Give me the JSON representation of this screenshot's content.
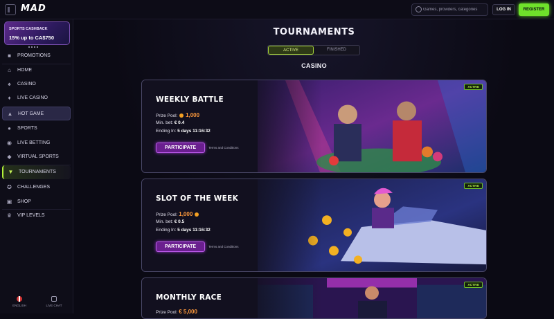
{
  "header": {
    "logo": "MAD",
    "search_placeholder": "Games, providers, categories",
    "login_label": "LOG IN",
    "register_label": "REGISTER"
  },
  "sidebar": {
    "promo": {
      "title": "SPORTS CASHBACK",
      "text": "15% up to CA$750"
    },
    "items": [
      {
        "label": "PROMOTIONS",
        "icon": "gift-icon"
      },
      {
        "label": "HOME",
        "icon": "home-icon"
      },
      {
        "label": "CASINO",
        "icon": "casino-icon"
      },
      {
        "label": "LIVE CASINO",
        "icon": "live-casino-icon"
      },
      {
        "label": "HOT GAME",
        "icon": "fire-icon"
      },
      {
        "label": "SPORTS",
        "icon": "ball-icon"
      },
      {
        "label": "LIVE BETTING",
        "icon": "live-icon"
      },
      {
        "label": "VIRTUAL SPORTS",
        "icon": "controller-icon"
      },
      {
        "label": "TOURNAMENTS",
        "icon": "trophy-icon"
      },
      {
        "label": "CHALLENGES",
        "icon": "medal-icon"
      },
      {
        "label": "SHOP",
        "icon": "shop-icon"
      },
      {
        "label": "VIP LEVELS",
        "icon": "crown-icon"
      }
    ],
    "footer": {
      "language": "ENGLISH",
      "chat": "LIVE CHAT"
    }
  },
  "main": {
    "title": "TOURNAMENTS",
    "tabs": {
      "active": "ACTIVE",
      "finished": "FINISHED"
    },
    "section": "CASINO",
    "cards": [
      {
        "badge": "ACTIVE",
        "title": "WEEKLY BATTLE",
        "prize_label": "Prize Pool:",
        "prize_value": "1,000",
        "minbet_label": "Min. bet:",
        "minbet_value": "€ 0.4",
        "ending_label": "Ending In:",
        "ending_value": "5 days 11:16:32",
        "button": "PARTICIPATE",
        "terms": "Terms and Conditions"
      },
      {
        "badge": "ACTIVE",
        "title": "SLOT OF THE WEEK",
        "prize_label": "Prize Pool:",
        "prize_value": "1,000",
        "minbet_label": "Min. bet:",
        "minbet_value": "€ 0.5",
        "ending_label": "Ending In:",
        "ending_value": "5 days 11:16:32",
        "button": "PARTICIPATE",
        "terms": "Terms and Conditions"
      },
      {
        "badge": "ACTIVE",
        "title": "MONTHLY RACE",
        "prize_label": "Prize Pool:",
        "prize_value": "€ 5,000"
      }
    ]
  }
}
